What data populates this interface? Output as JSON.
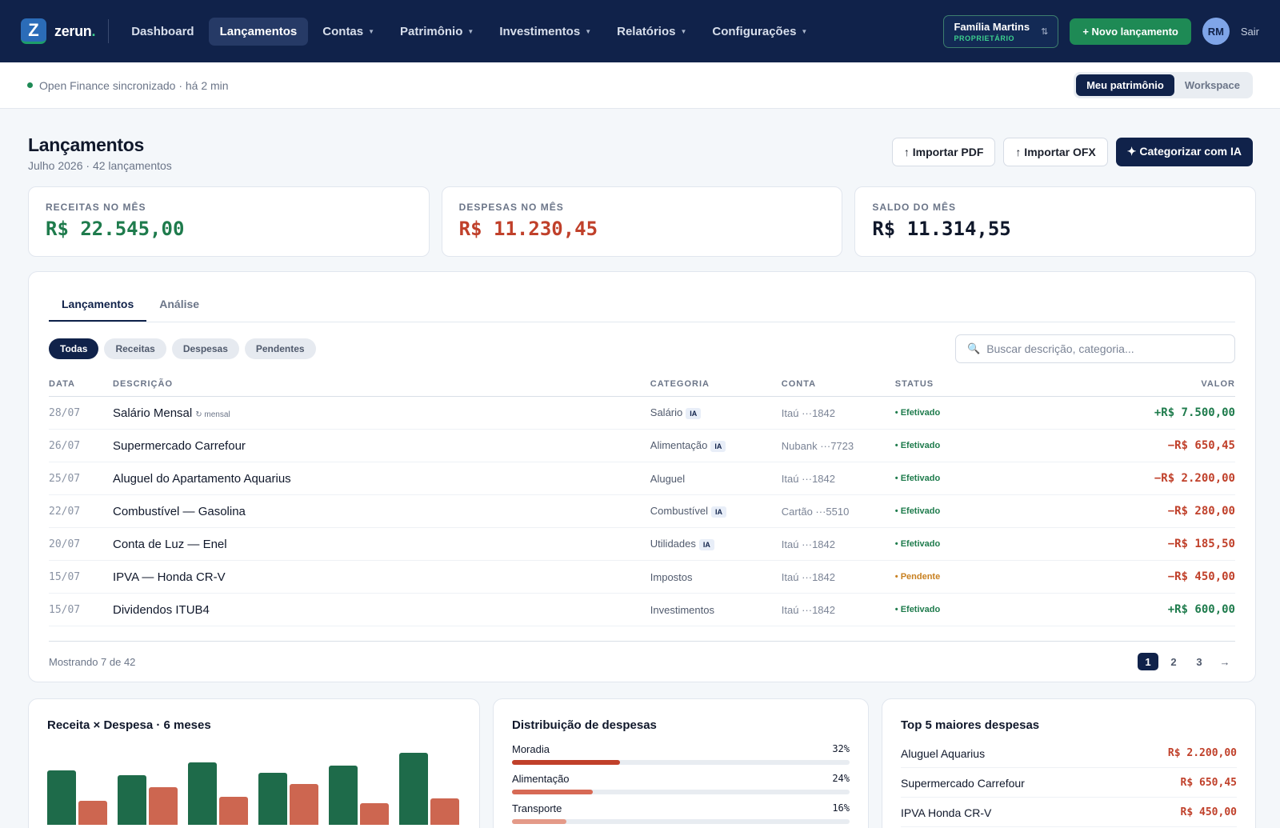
{
  "brand": {
    "logo_letter": "Z",
    "name": "zerun",
    "dot": "."
  },
  "nav": [
    {
      "label": "Dashboard",
      "active": false,
      "dropdown": false
    },
    {
      "label": "Lançamentos",
      "active": true,
      "dropdown": false
    },
    {
      "label": "Contas",
      "active": false,
      "dropdown": true
    },
    {
      "label": "Patrimônio",
      "active": false,
      "dropdown": true
    },
    {
      "label": "Investimentos",
      "active": false,
      "dropdown": true
    },
    {
      "label": "Relatórios",
      "active": false,
      "dropdown": true
    },
    {
      "label": "Configurações",
      "active": false,
      "dropdown": true
    }
  ],
  "account": {
    "family": "Família Martins",
    "role": "PROPRIETÁRIO",
    "initials": "RM",
    "logout": "Sair"
  },
  "new_button": "+ Novo lançamento",
  "sync": {
    "text": "Open Finance sincronizado · há 2 min"
  },
  "workspace_toggle": {
    "options": [
      "Meu patrimônio",
      "Workspace"
    ],
    "active": 0
  },
  "page": {
    "title": "Lançamentos",
    "subtitle": "Julho 2026 · 42 lançamentos",
    "actions": {
      "import_pdf": "↑ Importar PDF",
      "import_ofx": "↑ Importar OFX",
      "ai_categorize": "✦ Categorizar com IA"
    }
  },
  "kpis": [
    {
      "label": "RECEITAS NO MÊS",
      "value": "R$ 22.545,00",
      "tone": "green"
    },
    {
      "label": "DESPESAS NO MÊS",
      "value": "R$ 11.230,45",
      "tone": "red"
    },
    {
      "label": "SALDO DO MÊS",
      "value": "R$ 11.314,55",
      "tone": "dark"
    }
  ],
  "tabs": [
    "Lançamentos",
    "Análise"
  ],
  "filters": [
    "Todas",
    "Receitas",
    "Despesas",
    "Pendentes"
  ],
  "search": {
    "placeholder": "Buscar descrição, categoria..."
  },
  "table": {
    "headers": {
      "date": "DATA",
      "desc": "DESCRIÇÃO",
      "cat": "CATEGORIA",
      "acct": "CONTA",
      "status": "STATUS",
      "val": "VALOR"
    },
    "rows": [
      {
        "date": "28/07",
        "desc": "Salário Mensal",
        "recurring": "↻ mensal",
        "cat": "Salário",
        "ia": true,
        "acct": "Itaú ···1842",
        "status": "• Efetivado",
        "pending": false,
        "val": "+R$ 7.500,00",
        "positive": true
      },
      {
        "date": "26/07",
        "desc": "Supermercado Carrefour",
        "recurring": "",
        "cat": "Alimentação",
        "ia": true,
        "acct": "Nubank ···7723",
        "status": "• Efetivado",
        "pending": false,
        "val": "−R$ 650,45",
        "positive": false
      },
      {
        "date": "25/07",
        "desc": "Aluguel do Apartamento Aquarius",
        "recurring": "",
        "cat": "Aluguel",
        "ia": false,
        "acct": "Itaú ···1842",
        "status": "• Efetivado",
        "pending": false,
        "val": "−R$ 2.200,00",
        "positive": false
      },
      {
        "date": "22/07",
        "desc": "Combustível — Gasolina",
        "recurring": "",
        "cat": "Combustível",
        "ia": true,
        "acct": "Cartão ···5510",
        "status": "• Efetivado",
        "pending": false,
        "val": "−R$ 280,00",
        "positive": false
      },
      {
        "date": "20/07",
        "desc": "Conta de Luz — Enel",
        "recurring": "",
        "cat": "Utilidades",
        "ia": true,
        "acct": "Itaú ···1842",
        "status": "• Efetivado",
        "pending": false,
        "val": "−R$ 185,50",
        "positive": false
      },
      {
        "date": "15/07",
        "desc": "IPVA — Honda CR-V",
        "recurring": "",
        "cat": "Impostos",
        "ia": false,
        "acct": "Itaú ···1842",
        "status": "• Pendente",
        "pending": true,
        "val": "−R$ 450,00",
        "positive": false
      },
      {
        "date": "15/07",
        "desc": "Dividendos ITUB4",
        "recurring": "",
        "cat": "Investimentos",
        "ia": false,
        "acct": "Itaú ···1842",
        "status": "• Efetivado",
        "pending": false,
        "val": "+R$ 600,00",
        "positive": true
      }
    ],
    "ia_badge": "IA",
    "showing": "Mostrando 7 de 42",
    "pages": [
      "1",
      "2",
      "3"
    ],
    "next": "→"
  },
  "chart_card": {
    "title": "Receita × Despesa · 6 meses"
  },
  "chart_data": {
    "type": "bar",
    "title": "Receita × Despesa · 6 meses",
    "series": [
      {
        "values": [
          0.68,
          0.62,
          0.78,
          0.65,
          0.74,
          0.9
        ],
        "color": "#1e6b4a"
      },
      {
        "values": [
          0.3,
          0.47,
          0.35,
          0.51,
          0.27,
          0.33
        ],
        "color": "#cd6650"
      }
    ]
  },
  "distribution": {
    "title": "Distribuição de despesas",
    "items": [
      {
        "label": "Moradia",
        "pct": "32%",
        "fill": 0.32,
        "color": "#c0402a"
      },
      {
        "label": "Alimentação",
        "pct": "24%",
        "fill": 0.24,
        "color": "#d76a55"
      },
      {
        "label": "Transporte",
        "pct": "16%",
        "fill": 0.16,
        "color": "#e49a88"
      }
    ]
  },
  "top5": {
    "title": "Top 5 maiores despesas",
    "items": [
      {
        "label": "Aluguel Aquarius",
        "value": "R$ 2.200,00"
      },
      {
        "label": "Supermercado Carrefour",
        "value": "R$ 650,45"
      },
      {
        "label": "IPVA Honda CR-V",
        "value": "R$ 450,00"
      }
    ]
  }
}
